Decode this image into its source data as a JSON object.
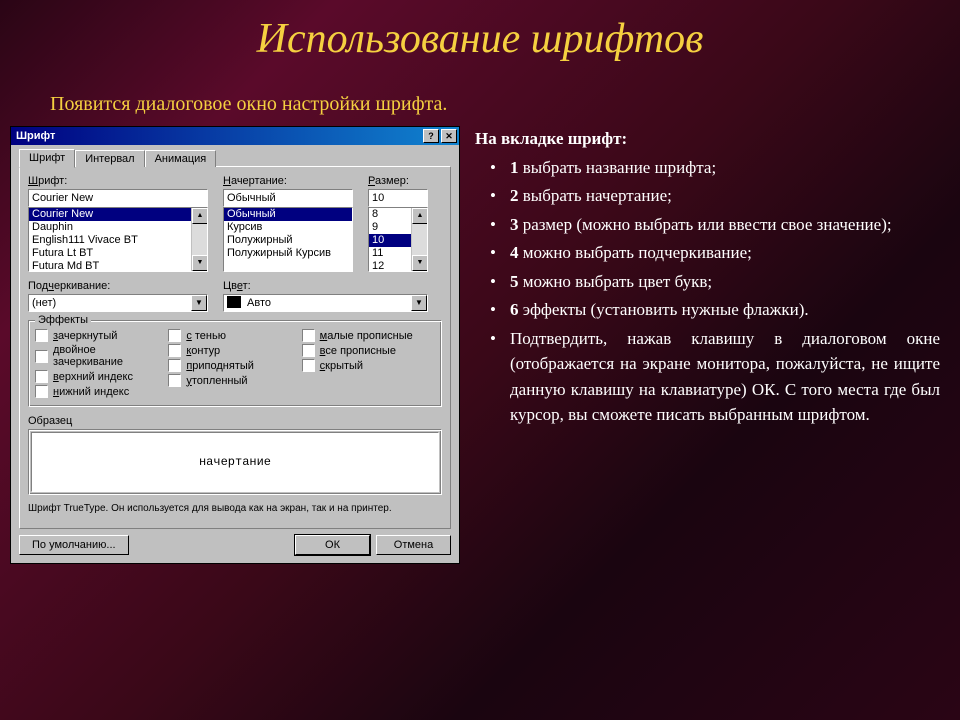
{
  "slide": {
    "title": "Использование шрифтов",
    "subtitle": "Появится диалоговое окно настройки шрифта."
  },
  "bullets": {
    "heading": "На вкладке шрифт:",
    "items": [
      {
        "n": "1",
        "t": "выбрать название шрифта;"
      },
      {
        "n": "2",
        "t": "выбрать начертание;"
      },
      {
        "n": "3",
        "t": "размер (можно выбрать или ввести свое значение);"
      },
      {
        "n": "4",
        "t": "можно выбрать подчеркивание;"
      },
      {
        "n": "5",
        "t": "можно выбрать цвет букв;"
      },
      {
        "n": "6",
        "t": "эффекты (установить нужные флажки)."
      }
    ],
    "confirm": "Подтвердить, нажав клавишу в диалоговом окне (отображается на экране монитора, пожалуйста, не ищите данную клавишу на клавиатуре) ОК. С того места где был курсор, вы сможете писать выбранным шрифтом."
  },
  "dialog": {
    "title": "Шрифт",
    "tabs": [
      "Шрифт",
      "Интервал",
      "Анимация"
    ],
    "labels": {
      "font": "Шрифт:",
      "style": "Начертание:",
      "size": "Размер:",
      "underline": "Подчеркивание:",
      "color": "Цвет:",
      "effects": "Эффекты",
      "sample": "Образец"
    },
    "font": {
      "value": "Courier New",
      "list": [
        "Courier New",
        "Dauphin",
        "English111 Vivace BT",
        "Futura Lt BT",
        "Futura Md BT"
      ]
    },
    "style": {
      "value": "Обычный",
      "list": [
        "Обычный",
        "Курсив",
        "Полужирный",
        "Полужирный Курсив"
      ]
    },
    "size": {
      "value": "10",
      "list": [
        "8",
        "9",
        "10",
        "11",
        "12"
      ]
    },
    "underline": "(нет)",
    "color": "Авто",
    "effects": {
      "col1": [
        "зачеркнутый",
        "двойное зачеркивание",
        "верхний индекс",
        "нижний индекс"
      ],
      "col2": [
        "с тенью",
        "контур",
        "приподнятый",
        "утопленный"
      ],
      "col3": [
        "малые прописные",
        "все прописные",
        "скрытый"
      ]
    },
    "preview": "начертание",
    "note": "Шрифт TrueType. Он используется для вывода как на экран, так и на принтер.",
    "buttons": {
      "default": "По умолчанию...",
      "ok": "ОК",
      "cancel": "Отмена"
    }
  }
}
